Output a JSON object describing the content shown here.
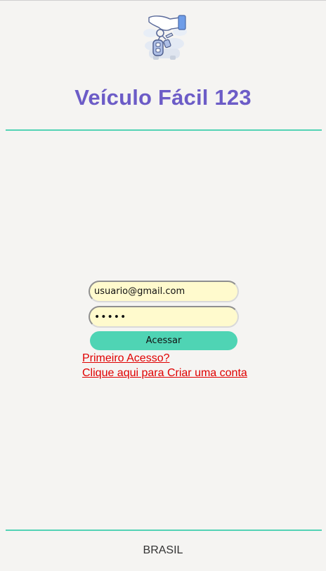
{
  "header": {
    "logo_icon": "hand-holding-car-keys-icon",
    "title": "Veículo Fácil 123"
  },
  "login": {
    "email_value": "usuario@gmail.com",
    "password_value": "•••••",
    "submit_label": "Acessar",
    "first_access_link": "Primeiro Acesso?",
    "create_account_link": "Clique aqui para Criar uma conta"
  },
  "footer": {
    "country": "BRASIL"
  },
  "colors": {
    "title": "#6c5cc7",
    "accent": "#4fd4b4",
    "link": "#e00000",
    "input_background": "#fffacd",
    "page_background": "#f5f4f2"
  }
}
